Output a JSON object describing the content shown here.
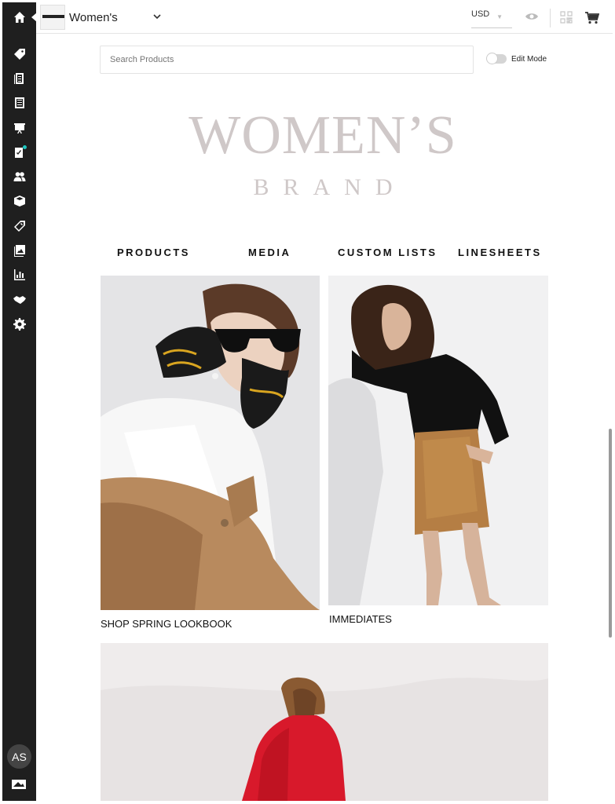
{
  "topbar": {
    "brand_name": "Women's",
    "currency": "USD"
  },
  "sidebar": {
    "avatar_initials": "AS",
    "icons": [
      "home-icon",
      "tag-icon",
      "orders-icon",
      "catalog-icon",
      "presentation-icon",
      "tasks-icon",
      "contacts-icon",
      "box-icon",
      "promotions-icon",
      "media-icon",
      "reports-icon",
      "partners-icon",
      "settings-icon"
    ]
  },
  "main": {
    "search_placeholder": "Search Products",
    "edit_mode_label": "Edit Mode",
    "logo_title": "WOMEN’S",
    "logo_subtitle": "BRAND",
    "nav": [
      "PRODUCTS",
      "MEDIA",
      "CUSTOM LISTS",
      "LINESHEETS"
    ],
    "tiles": [
      {
        "caption": "SHOP SPRING LOOKBOOK"
      },
      {
        "caption": "IMMEDIATES"
      }
    ]
  },
  "colors": {
    "sidebar_bg": "#1f1f1f",
    "accent_dot": "#1ec6c0",
    "logo": "#cfc8c8"
  }
}
